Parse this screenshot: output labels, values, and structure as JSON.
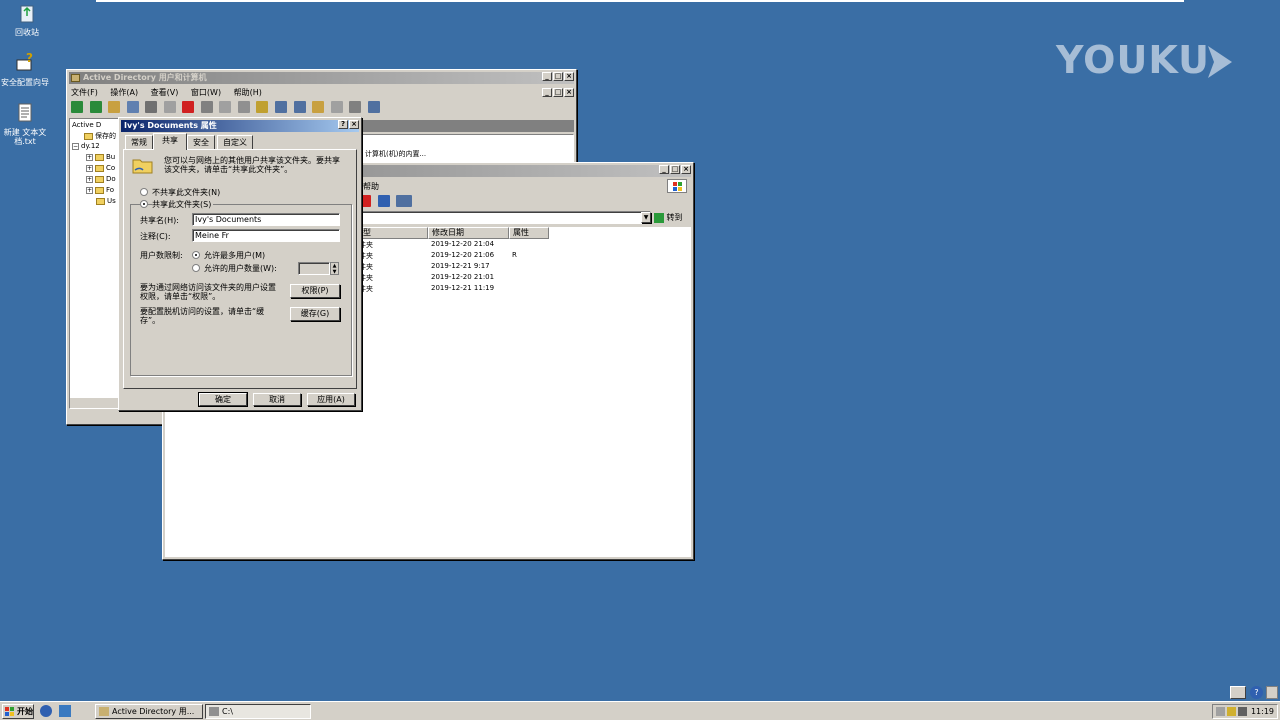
{
  "desktop": {
    "icons": [
      {
        "label": "回收站",
        "icon": "recycle-bin-icon"
      },
      {
        "label": "安全配置向导",
        "icon": "security-wizard-icon"
      },
      {
        "label": "新建 文本文档.txt",
        "icon": "text-file-icon"
      }
    ],
    "watermark": "YOUKU"
  },
  "ad_window": {
    "title": "Active Directory 用户和计算机",
    "menu": [
      "文件(F)",
      "操作(A)",
      "查看(V)",
      "窗口(W)",
      "帮助(H)"
    ],
    "tree": [
      "Active D",
      "保存的",
      "dy.12",
      "Bu",
      "Co",
      "Do",
      "Fo",
      "Us"
    ],
    "desc_text": "计算机(机)的内置..."
  },
  "explorer_window": {
    "menu_help": "帮助",
    "go_label": "转到",
    "columns": [
      "型",
      "修改日期",
      "属性"
    ],
    "rows": [
      {
        "type": "件夹",
        "date": "2019-12-20 21:04",
        "attr": ""
      },
      {
        "type": "件夹",
        "date": "2019-12-20 21:06",
        "attr": "R"
      },
      {
        "type": "件夹",
        "date": "2019-12-21 9:17",
        "attr": ""
      },
      {
        "type": "件夹",
        "date": "2019-12-20 21:01",
        "attr": ""
      },
      {
        "type": "件夹",
        "date": "2019-12-21 11:19",
        "attr": ""
      }
    ]
  },
  "dialog": {
    "title": "Ivy's Documents 属性",
    "tabs": [
      "常规",
      "共享",
      "安全",
      "自定义"
    ],
    "intro": "您可以与网络上的其他用户共享该文件夹。要共享该文件夹，请单击“共享此文件夹”。",
    "opt_no_share": "不共享此文件夹(N)",
    "opt_share": "共享此文件夹(S)",
    "share_name_label": "共享名(H):",
    "share_name_value": "Ivy's Documents",
    "comment_label": "注释(C):",
    "comment_value": "Meine Fr",
    "user_limit_label": "用户数限制:",
    "opt_max_users": "允许最多用户(M)",
    "opt_allowed_users": "允许的用户数量(W):",
    "perm_text": "要为通过网络访问该文件夹的用户设置权限，请单击“权限”。",
    "perm_button": "权限(P)",
    "cache_text": "要配置脱机访问的设置，请单击“缓存”。",
    "cache_button": "缓存(G)",
    "ok_button": "确定",
    "cancel_button": "取消",
    "apply_button": "应用(A)"
  },
  "taskbar": {
    "start": "开始",
    "tasks": [
      "Active Directory 用...",
      "C:\\"
    ],
    "clock": "11:19"
  }
}
